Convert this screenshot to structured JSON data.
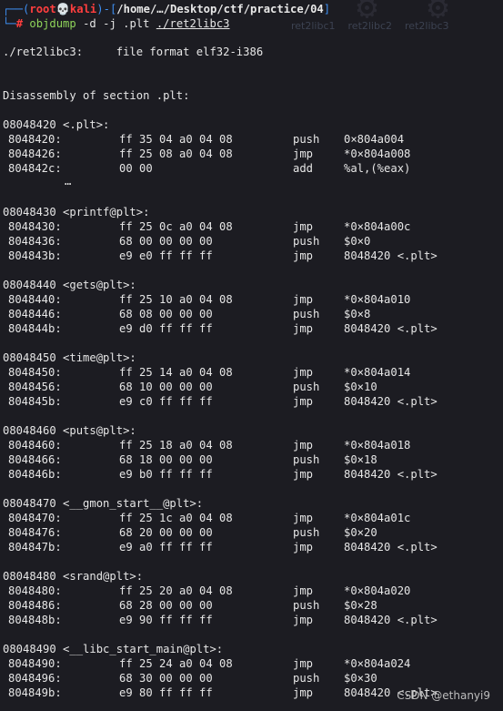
{
  "prompt": {
    "user": "root",
    "host": "kali",
    "path": "/home/…/Desktop/ctf/practice/04",
    "symbol": "#",
    "command": "objdump",
    "flags": "-d -j .plt",
    "file": "./ret2libc3"
  },
  "background_tabs": [
    "ret2libc1",
    "ret2libc2",
    "ret2libc3"
  ],
  "file_format_line": "./ret2libc3:     file format elf32-i386",
  "section_line": "Disassembly of section .plt:",
  "sections": [
    {
      "header": "08048420 <.plt>:",
      "rows": [
        {
          "addr": "8048420:",
          "bytes": "ff 35 04 a0 04 08",
          "op": "push",
          "arg": "0×804a004"
        },
        {
          "addr": "8048426:",
          "bytes": "ff 25 08 a0 04 08",
          "op": "jmp",
          "arg": "*0×804a008"
        },
        {
          "addr": "804842c:",
          "bytes": "00 00",
          "op": "add",
          "arg": "%al,(%eax)"
        }
      ],
      "ellipsis": "…"
    },
    {
      "header": "08048430 <printf@plt>:",
      "rows": [
        {
          "addr": "8048430:",
          "bytes": "ff 25 0c a0 04 08",
          "op": "jmp",
          "arg": "*0×804a00c"
        },
        {
          "addr": "8048436:",
          "bytes": "68 00 00 00 00",
          "op": "push",
          "arg": "$0×0"
        },
        {
          "addr": "804843b:",
          "bytes": "e9 e0 ff ff ff",
          "op": "jmp",
          "arg": "8048420 <.plt>"
        }
      ]
    },
    {
      "header": "08048440 <gets@plt>:",
      "rows": [
        {
          "addr": "8048440:",
          "bytes": "ff 25 10 a0 04 08",
          "op": "jmp",
          "arg": "*0×804a010"
        },
        {
          "addr": "8048446:",
          "bytes": "68 08 00 00 00",
          "op": "push",
          "arg": "$0×8"
        },
        {
          "addr": "804844b:",
          "bytes": "e9 d0 ff ff ff",
          "op": "jmp",
          "arg": "8048420 <.plt>"
        }
      ]
    },
    {
      "header": "08048450 <time@plt>:",
      "rows": [
        {
          "addr": "8048450:",
          "bytes": "ff 25 14 a0 04 08",
          "op": "jmp",
          "arg": "*0×804a014"
        },
        {
          "addr": "8048456:",
          "bytes": "68 10 00 00 00",
          "op": "push",
          "arg": "$0×10"
        },
        {
          "addr": "804845b:",
          "bytes": "e9 c0 ff ff ff",
          "op": "jmp",
          "arg": "8048420 <.plt>"
        }
      ]
    },
    {
      "header": "08048460 <puts@plt>:",
      "rows": [
        {
          "addr": "8048460:",
          "bytes": "ff 25 18 a0 04 08",
          "op": "jmp",
          "arg": "*0×804a018"
        },
        {
          "addr": "8048466:",
          "bytes": "68 18 00 00 00",
          "op": "push",
          "arg": "$0×18"
        },
        {
          "addr": "804846b:",
          "bytes": "e9 b0 ff ff ff",
          "op": "jmp",
          "arg": "8048420 <.plt>"
        }
      ]
    },
    {
      "header": "08048470 <__gmon_start__@plt>:",
      "rows": [
        {
          "addr": "8048470:",
          "bytes": "ff 25 1c a0 04 08",
          "op": "jmp",
          "arg": "*0×804a01c"
        },
        {
          "addr": "8048476:",
          "bytes": "68 20 00 00 00",
          "op": "push",
          "arg": "$0×20"
        },
        {
          "addr": "804847b:",
          "bytes": "e9 a0 ff ff ff",
          "op": "jmp",
          "arg": "8048420 <.plt>"
        }
      ]
    },
    {
      "header": "08048480 <srand@plt>:",
      "rows": [
        {
          "addr": "8048480:",
          "bytes": "ff 25 20 a0 04 08",
          "op": "jmp",
          "arg": "*0×804a020"
        },
        {
          "addr": "8048486:",
          "bytes": "68 28 00 00 00",
          "op": "push",
          "arg": "$0×28"
        },
        {
          "addr": "804848b:",
          "bytes": "e9 90 ff ff ff",
          "op": "jmp",
          "arg": "8048420 <.plt>"
        }
      ]
    },
    {
      "header": "08048490 <__libc_start_main@plt>:",
      "rows": [
        {
          "addr": "8048490:",
          "bytes": "ff 25 24 a0 04 08",
          "op": "jmp",
          "arg": "*0×804a024"
        },
        {
          "addr": "8048496:",
          "bytes": "68 30 00 00 00",
          "op": "push",
          "arg": "$0×30"
        },
        {
          "addr": "804849b:",
          "bytes": "e9 80 ff ff ff",
          "op": "jmp",
          "arg": "8048420 <.plt>"
        }
      ]
    }
  ],
  "watermark": "CSDN @ethanyi9",
  "colors": {
    "background": "#1c1c22",
    "prompt_frame": "#3e8ef0",
    "prompt_user": "#ff3e3e",
    "command": "#8fd45a",
    "text": "#e6e6e6"
  }
}
